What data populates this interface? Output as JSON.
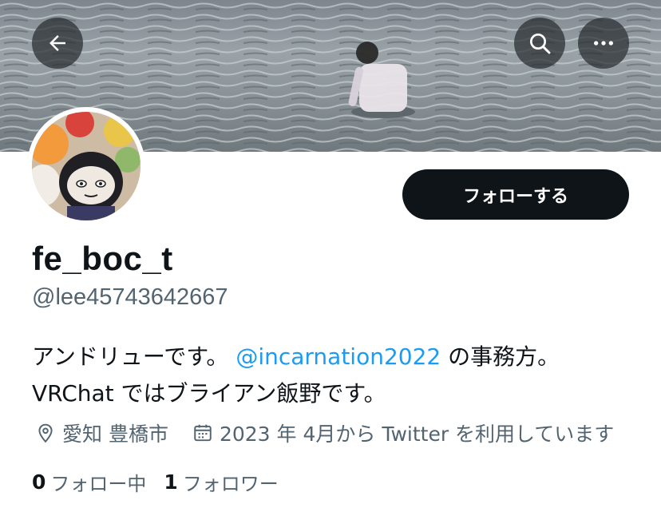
{
  "header": {
    "back_icon": "arrow-left-icon",
    "search_icon": "search-icon",
    "more_icon": "more-horizontal-icon"
  },
  "profile": {
    "display_name": "fe_boc_t",
    "handle": "@lee45743642667",
    "follow_label": "フォローする",
    "bio": {
      "prefix": "アンドリューです。 ",
      "mention": "@incarnation2022",
      "suffix": " の事務方。",
      "line2": "VRChat ではブライアン飯野です。"
    },
    "location": "愛知 豊橋市",
    "joined": "2023 年 4月から Twitter を利用しています",
    "following_count": "0",
    "following_label": "フォロー中",
    "followers_count": "1",
    "followers_label": "フォロワー"
  },
  "colors": {
    "accent": "#1d9bf0",
    "text": "#0f1419",
    "secondary": "#536471"
  }
}
